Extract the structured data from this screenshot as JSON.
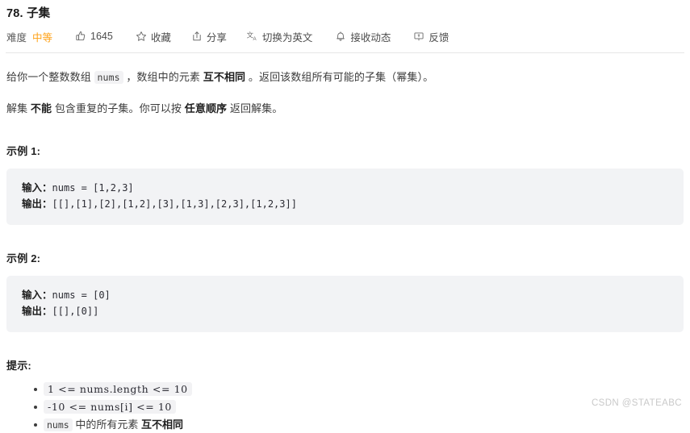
{
  "header": {
    "title": "78. 子集",
    "toolbar": {
      "difficulty_label": "难度",
      "difficulty_value": "中等",
      "difficulty_color": "#ffa116",
      "likes_count": "1645",
      "favorite_label": "收藏",
      "share_label": "分享",
      "translate_label": "切换为英文",
      "subscribe_label": "接收动态",
      "feedback_label": "反馈",
      "icons": {
        "thumbs_up": "thumbs-up-icon",
        "star": "star-icon",
        "share": "share-icon",
        "translate": "translate-icon",
        "bell": "bell-icon",
        "feedback": "feedback-icon"
      }
    }
  },
  "description": {
    "paragraph1": {
      "pre": "给你一个整数数组 ",
      "code": "nums",
      "mid": " ，数组中的元素 ",
      "bold": "互不相同",
      "post": " 。返回该数组所有可能的子集（幂集）。"
    },
    "paragraph2": {
      "pre": "解集 ",
      "bold1": "不能",
      "mid": " 包含重复的子集。你可以按 ",
      "bold2": "任意顺序",
      "post": " 返回解集。"
    }
  },
  "examples": [
    {
      "title": "示例 1:",
      "input_label": "输入：",
      "input_value": "nums = [1,2,3]",
      "output_label": "输出：",
      "output_value": "[[],[1],[2],[1,2],[3],[1,3],[2,3],[1,2,3]]"
    },
    {
      "title": "示例 2:",
      "input_label": "输入：",
      "input_value": "nums = [0]",
      "output_label": "输出：",
      "output_value": "[[],[0]]"
    }
  ],
  "hints": {
    "title": "提示:",
    "items": [
      {
        "type": "math",
        "math": "1 <= nums.length <= 10"
      },
      {
        "type": "math",
        "math": "-10 <= nums[i] <= 10"
      },
      {
        "type": "mixed",
        "code": "nums",
        "text": " 中的所有元素 ",
        "bold": "互不相同"
      }
    ]
  },
  "watermark": "CSDN @STATEABC"
}
